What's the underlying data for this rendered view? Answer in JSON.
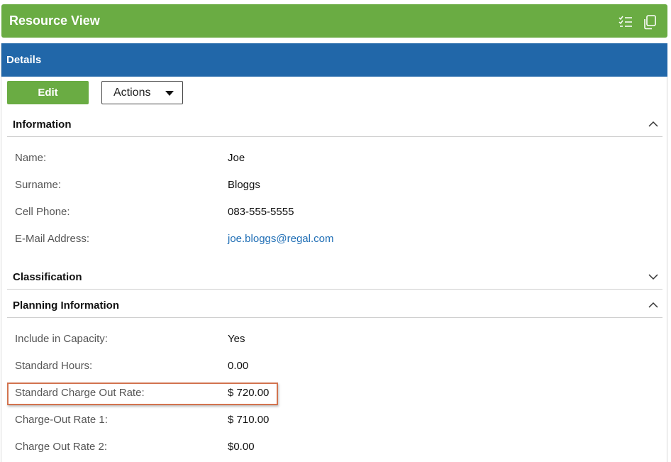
{
  "app": {
    "title": "Resource View",
    "icons": [
      "checklist-icon",
      "copy-icon"
    ]
  },
  "details": {
    "header": "Details",
    "edit_label": "Edit",
    "actions_label": "Actions"
  },
  "sections": {
    "information": {
      "title": "Information",
      "expanded": true,
      "fields": [
        {
          "label": "Name:",
          "value": "Joe"
        },
        {
          "label": "Surname:",
          "value": "Bloggs"
        },
        {
          "label": "Cell Phone:",
          "value": "083-555-5555"
        },
        {
          "label": "E-Mail Address:",
          "value": "joe.bloggs@regal.com"
        }
      ]
    },
    "classification": {
      "title": "Classification",
      "expanded": false
    },
    "planning": {
      "title": "Planning Information",
      "expanded": true,
      "fields": [
        {
          "label": "Include in Capacity:",
          "value": "Yes"
        },
        {
          "label": "Standard Hours:",
          "value": "0.00"
        },
        {
          "label": "Standard Charge Out Rate:",
          "value": "$ 720.00",
          "highlighted": true
        },
        {
          "label": "Charge-Out Rate 1:",
          "value": "$ 710.00"
        },
        {
          "label": "Charge Out Rate 2:",
          "value": "$0.00"
        }
      ]
    }
  },
  "colors": {
    "title_bar": "#6aac43",
    "panel_header": "#2167a9",
    "link": "#1f6eb5",
    "highlight_border": "#d2734f"
  }
}
